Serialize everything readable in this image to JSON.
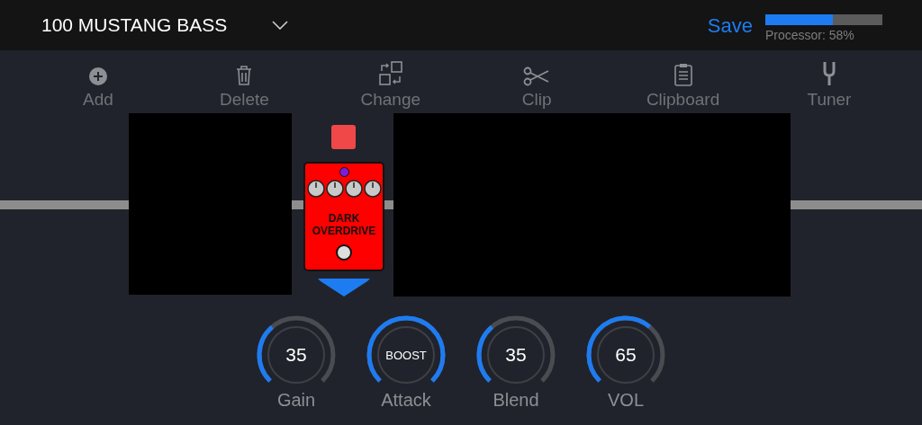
{
  "preset": {
    "name": "100 MUSTANG BASS"
  },
  "header": {
    "save": "Save",
    "processor": {
      "label": "Processor: 58%",
      "level": 0.58
    }
  },
  "toolbar": [
    {
      "label": "Add"
    },
    {
      "label": "Delete"
    },
    {
      "label": "Change"
    },
    {
      "label": "Clip"
    },
    {
      "label": "Clipboard"
    },
    {
      "label": "Tuner"
    }
  ],
  "pedal": {
    "name_line_1": "DARK",
    "name_line_2": "OVERDRIVE"
  },
  "knobs": [
    {
      "value": "35",
      "label": "Gain",
      "kind": "number"
    },
    {
      "value": "BOOST",
      "label": "Attack",
      "kind": "text"
    },
    {
      "value": "35",
      "label": "Blend",
      "kind": "number"
    },
    {
      "value": "65",
      "label": "VOL",
      "kind": "number"
    }
  ]
}
